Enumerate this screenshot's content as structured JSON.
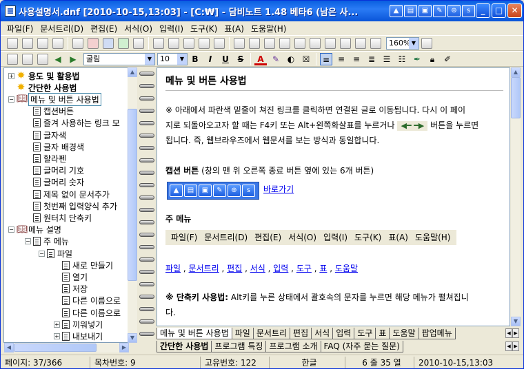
{
  "window": {
    "title": "사용설명서.dnf [2010-10-15,13:03] - [C:₩] - 담비노트 1.48 베타6 (남은 사...",
    "min": "_",
    "max": "□",
    "close": "✕"
  },
  "title_mini_buttons": [
    "▲",
    "▤",
    "▣",
    "✎",
    "⊕",
    "s"
  ],
  "menu": [
    "파일(F)",
    "문서트리(D)",
    "편집(E)",
    "서식(O)",
    "입력(I)",
    "도구(K)",
    "표(A)",
    "도움말(H)"
  ],
  "toolbar": {
    "zoom": "160%",
    "font": "굴림",
    "font_size": "10",
    "bold": "B",
    "italic": "I",
    "underline": "U",
    "strike": "S"
  },
  "tree": [
    {
      "label": "용도 및 활용법",
      "icon": "star",
      "level": 0,
      "exp": "+",
      "bold": true
    },
    {
      "label": "간단한 사용법",
      "icon": "star",
      "level": 0,
      "exp": "",
      "bold": true
    },
    {
      "label": "메뉴 및 버튼 사용법",
      "icon": "book",
      "level": 0,
      "exp": "−",
      "sel": true
    },
    {
      "label": "캡션버튼",
      "icon": "doc",
      "level": 1
    },
    {
      "label": "즐겨 사용하는 링크 모",
      "icon": "doc",
      "level": 1
    },
    {
      "label": "글자색",
      "icon": "doc",
      "level": 1
    },
    {
      "label": "글자 배경색",
      "icon": "doc",
      "level": 1
    },
    {
      "label": "할라펜",
      "icon": "doc",
      "level": 1
    },
    {
      "label": "글머리 기호",
      "icon": "doc",
      "level": 1
    },
    {
      "label": "글머리 숫자",
      "icon": "doc",
      "level": 1
    },
    {
      "label": "제목 없이 문서추가",
      "icon": "doc",
      "level": 1
    },
    {
      "label": "첫번째 입력양식 추가",
      "icon": "doc",
      "level": 1
    },
    {
      "label": "원터치 단축키",
      "icon": "doc",
      "level": 1
    },
    {
      "label": "메뉴 설명",
      "icon": "book",
      "level": 0,
      "exp": "−"
    },
    {
      "label": "주 메뉴",
      "icon": "doc",
      "level": 1,
      "exp": "−"
    },
    {
      "label": "파일",
      "icon": "doc",
      "level": 2,
      "exp": "−"
    },
    {
      "label": "새로 만들기",
      "icon": "doc",
      "level": 3
    },
    {
      "label": "열기",
      "icon": "doc",
      "level": 3
    },
    {
      "label": "저장",
      "icon": "doc",
      "level": 3
    },
    {
      "label": "다른 이름으로",
      "icon": "doc",
      "level": 3
    },
    {
      "label": "다른 이름으로",
      "icon": "doc",
      "level": 3
    },
    {
      "label": "끼워넣기",
      "icon": "doc",
      "level": 3,
      "exp": "+"
    },
    {
      "label": "내보내기",
      "icon": "doc",
      "level": 3,
      "exp": "+"
    }
  ],
  "content": {
    "title": "메뉴 및 버튼 사용법",
    "para1_a": "※ 아래에서 파란색 밑줄이 쳐진 링크를 클릭하면 연결된 글로 이동됩니다. 다시 이 페이",
    "para1_b": "지로 되돌아오고자 할 때는 F4키 또는 Alt+왼쪽화살표를 누르거나",
    "para1_c": "버튼을 누르면",
    "para1_d": "됩니다. 즉, 웹브라우즈에서 웹문서를 보는 방식과 동일합니다.",
    "caption_heading": "캡션 버튼",
    "caption_note": " (창의 맨 위 오른쪽 종료 버튼 옆에 있는 6개 버튼)",
    "caption_buttons": [
      "▲",
      "▤",
      "▣",
      "✎",
      "⊕",
      "s"
    ],
    "shortcut_link": "바로가기",
    "main_menu_heading": "주 메뉴",
    "main_menu_items": [
      "파일(F)",
      "문서트리(D)",
      "편집(E)",
      "서식(O)",
      "입력(I)",
      "도구(K)",
      "표(A)",
      "도움말(H)"
    ],
    "links": [
      "파일",
      "문서트리",
      "편집",
      "서식",
      "입력",
      "도구",
      "표",
      "도움말"
    ],
    "shortcut_heading": "※ 단축키 사용법:",
    "shortcut_text": " Alt키를 누른 상태에서 괄호속의 문자를 누르면 해당 메뉴가 펼쳐집니",
    "shortcut_text2": "다."
  },
  "tabs_row1": [
    "메뉴 및 버튼 사용법",
    "파일",
    "문서트리",
    "편집",
    "서식",
    "입력",
    "도구",
    "표",
    "도움말",
    "팝업메뉴"
  ],
  "tabs_row2": [
    "간단한 사용법",
    "프로그램 특징",
    "프로그램 소개",
    "FAQ (자주 묻는 질문)"
  ],
  "status": {
    "page": "페이지: 37/366",
    "toc": "목차번호: 9",
    "unique": "고유번호: 122",
    "lang": "한글",
    "pos": "6 줄 35 열",
    "date": "2010-10-15,13:03"
  }
}
